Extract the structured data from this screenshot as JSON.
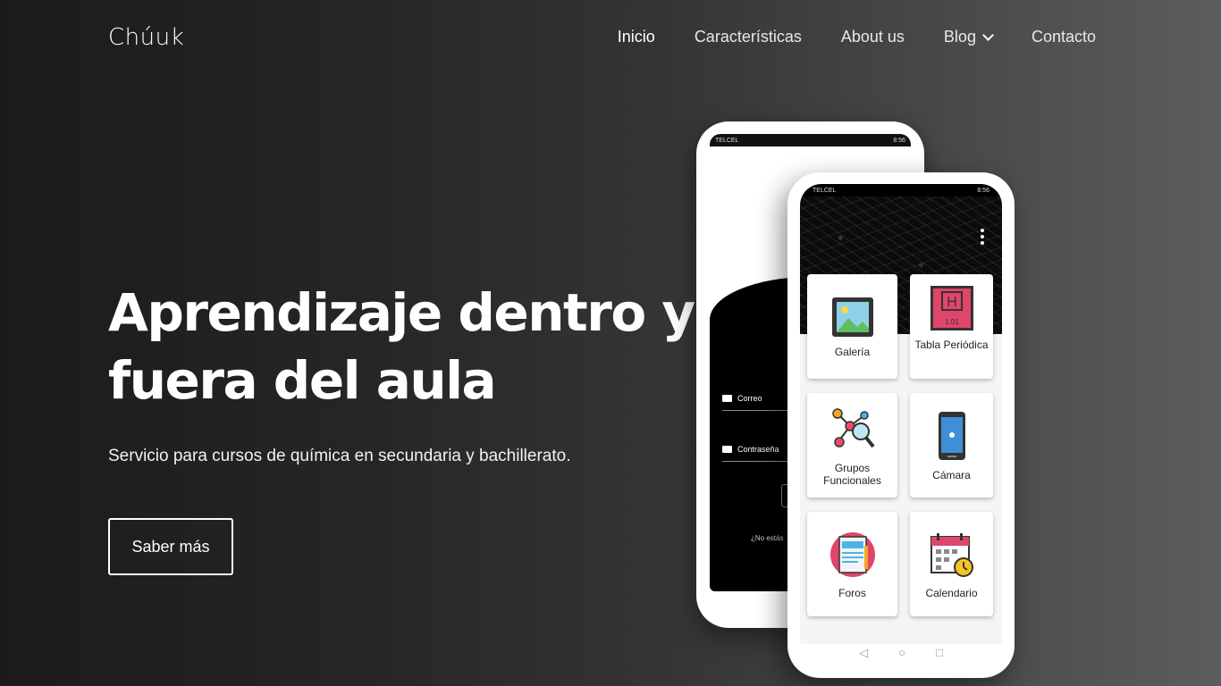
{
  "header": {
    "brand": "Chúuk",
    "nav": [
      {
        "label": "Inicio"
      },
      {
        "label": "Características"
      },
      {
        "label": "About us"
      },
      {
        "label": "Blog"
      },
      {
        "label": "Contacto"
      }
    ]
  },
  "hero": {
    "title_line1": "Aprendizaje dentro y",
    "title_line2": "fuera del aula",
    "subtitle": "Servicio para cursos de química en secundaria y bachillerato.",
    "cta": "Saber más"
  },
  "phone_back": {
    "status_left": "TELCEL",
    "status_right": "8:56",
    "email_label": "Correo",
    "password_label": "Contraseña",
    "signup_text": "¿No estás"
  },
  "phone_front": {
    "status_left": "TELCEL",
    "status_right": "8:56",
    "tiles": [
      {
        "label": "Galería",
        "icon": "gallery-icon"
      },
      {
        "label": "Tabla Periódica",
        "icon": "periodic-table-icon",
        "element_symbol": "H",
        "element_mass": "1.01"
      },
      {
        "label": "Grupos Funcionales",
        "icon": "molecule-search-icon"
      },
      {
        "label": "Cámara",
        "icon": "phone-camera-icon"
      },
      {
        "label": "Foros",
        "icon": "forum-icon"
      },
      {
        "label": "Calendario",
        "icon": "calendar-icon"
      }
    ]
  },
  "colors": {
    "text": "#ffffff",
    "periodic_bg": "#e0456b",
    "gallery_bg": "#8fd0e8"
  }
}
